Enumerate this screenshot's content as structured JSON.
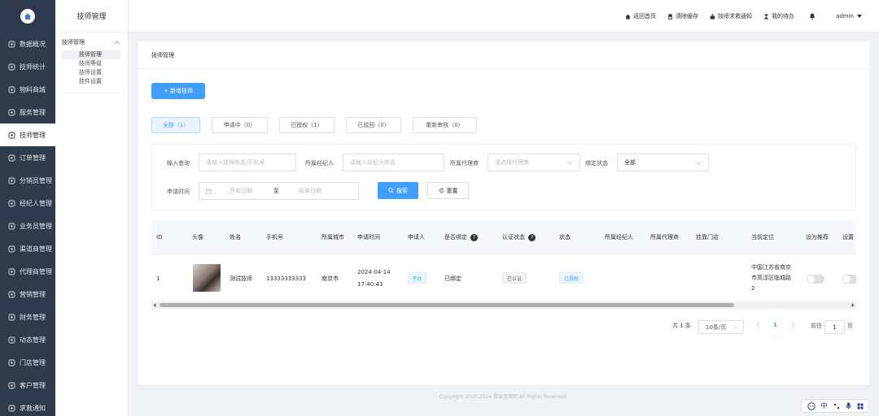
{
  "sidebar": {
    "items": [
      {
        "label": "数据概况",
        "icon": "dashboard-icon"
      },
      {
        "label": "技师统计",
        "icon": "bar-chart-icon"
      },
      {
        "label": "物料商城",
        "icon": "shopping-bag-icon"
      },
      {
        "label": "服务管理",
        "icon": "service-icon"
      },
      {
        "label": "技师管理",
        "icon": "technician-icon",
        "active": true
      },
      {
        "label": "订单管理",
        "icon": "order-icon"
      },
      {
        "label": "分销员管理",
        "icon": "distributor-icon"
      },
      {
        "label": "经纪人管理",
        "icon": "agent-icon"
      },
      {
        "label": "业务员管理",
        "icon": "salesman-icon"
      },
      {
        "label": "渠道商管理",
        "icon": "channel-icon"
      },
      {
        "label": "代理商管理",
        "icon": "proxy-icon"
      },
      {
        "label": "营销管理",
        "icon": "marketing-icon"
      },
      {
        "label": "财务管理",
        "icon": "finance-icon"
      },
      {
        "label": "动态管理",
        "icon": "dynamic-icon"
      },
      {
        "label": "门店管理",
        "icon": "store-icon"
      },
      {
        "label": "客户管理",
        "icon": "customer-icon"
      },
      {
        "label": "求救通知",
        "icon": "bell-icon"
      }
    ]
  },
  "subnav": {
    "title": "技师管理",
    "group": "技师管理",
    "items": [
      {
        "label": "技师管理",
        "active": true
      },
      {
        "label": "技师等级"
      },
      {
        "label": "技师设置"
      },
      {
        "label": "挂件设置"
      }
    ]
  },
  "topbar": {
    "links": [
      {
        "label": "返回首页",
        "icon": "home-icon"
      },
      {
        "label": "清除缓存",
        "icon": "broom-icon"
      },
      {
        "label": "技师求救通知",
        "icon": "alert-icon"
      },
      {
        "label": "我的待办",
        "icon": "hourglass-icon"
      },
      {
        "label": "",
        "icon": "notification-bell-icon"
      }
    ],
    "user": "admin"
  },
  "page": {
    "breadcrumb": "技师管理",
    "add_button": "+ 新增技师",
    "tabs": [
      {
        "label": "全部（1）",
        "active": true
      },
      {
        "label": "申请中（0）"
      },
      {
        "label": "已授权（1）"
      },
      {
        "label": "已驳回（0）"
      },
      {
        "label": "重新审核（0）"
      }
    ]
  },
  "filter": {
    "keyword_label": "输入查询",
    "keyword_placeholder": "请输入技师姓名/手机号",
    "agent_label": "所属经纪人",
    "agent_placeholder": "请输入经纪人姓名",
    "proxy_label": "所属代理商",
    "proxy_placeholder": "请选择代理商",
    "bind_label": "绑定状态",
    "bind_value": "全部",
    "date_label": "申请时间",
    "date_start_placeholder": "开始日期",
    "date_separator": "至",
    "date_end_placeholder": "结束日期",
    "search_button": "搜索",
    "reset_button": "重置"
  },
  "table": {
    "columns": [
      "ID",
      "头像",
      "姓名",
      "手机号",
      "所属城市",
      "申请时间",
      "申请人",
      "是否绑定",
      "认证状态",
      "状态",
      "所属经纪人",
      "所属代理商",
      "挂靠门店",
      "当前定位",
      "设为推荐",
      "设置"
    ],
    "rows": [
      {
        "id": "1",
        "name": "测试技师",
        "phone": "13333333333",
        "city": "南京市",
        "apply_date": "2024-04-14",
        "apply_time": "17:40:43",
        "applicant": "平台",
        "bind": "已绑定",
        "auth": "已认证",
        "status": "已授权",
        "location_line1": "中国江苏省南京",
        "location_line2": "市高淳区临城路",
        "location_line3": "2"
      }
    ]
  },
  "pagination": {
    "total": "共 1 条",
    "page_size": "10条/页",
    "current_page": "1",
    "goto_label": "前往",
    "goto_value": "1",
    "page_unit": "页"
  },
  "footer": "Copyright 2020-2024 晋级按摩网 All Rights Reserved.",
  "ime": {
    "lang": "中"
  }
}
